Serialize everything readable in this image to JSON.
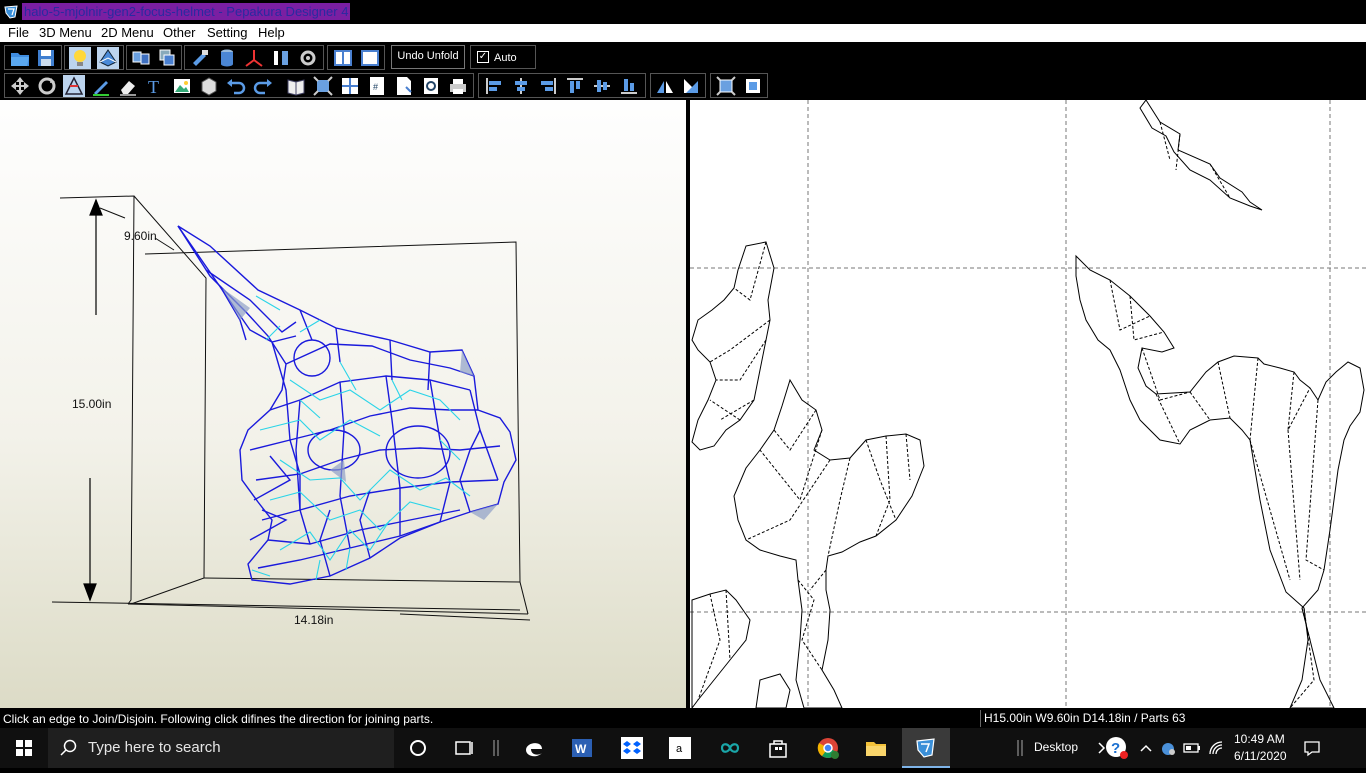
{
  "window": {
    "title": "halo-5-mjolnir-gen2-focus-helmet - Pepakura Designer 4"
  },
  "menu": [
    "File",
    "3D Menu",
    "2D Menu",
    "Other",
    "Setting",
    "Help"
  ],
  "toolbar": {
    "undo_unfold": "Undo Unfold",
    "auto_label": "Auto",
    "auto_checked": true
  },
  "view3d": {
    "depth_label": "9.60in",
    "height_label": "15.00in",
    "width_label": "14.18in"
  },
  "status": {
    "hint": "Click an edge to Join/Disjoin. Following click difines the direction for joining parts.",
    "dimensions": "H15.00in W9.60in D14.18in / Parts 63"
  },
  "taskbar": {
    "search_placeholder": "Type here to search",
    "desktop_label": "Desktop",
    "time": "10:49 AM",
    "date": "6/11/2020"
  },
  "colors": {
    "mesh_blue": "#1a1adc",
    "mesh_cyan": "#2ad4e8",
    "chrome": "#000000",
    "accent": "#7fb4e8"
  }
}
